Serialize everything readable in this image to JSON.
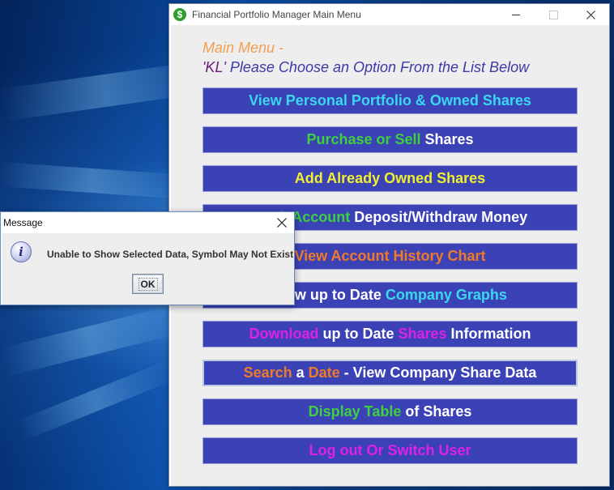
{
  "window": {
    "title": "Financial Portfolio Manager Main Menu",
    "icon": "dollar-icon",
    "icon_glyph": "$"
  },
  "header": {
    "line1": "Main Menu -",
    "user_quote": "'KL'",
    "line2_rest": " Please Choose an Option From the List Below"
  },
  "menu": {
    "items": [
      {
        "id": "view-portfolio",
        "parts": [
          {
            "text": "View Personal Portfolio & Owned Shares",
            "color": "cyan"
          }
        ]
      },
      {
        "id": "purchase-sell",
        "parts": [
          {
            "text": "Purchase or Sell",
            "color": "green"
          },
          {
            "text": " Shares",
            "color": "white"
          }
        ]
      },
      {
        "id": "add-owned",
        "parts": [
          {
            "text": "Add Already Owned Shares",
            "color": "yellow"
          }
        ]
      },
      {
        "id": "bank-account",
        "parts": [
          {
            "text": "Bank Account",
            "color": "green"
          },
          {
            "text": " Deposit/Withdraw Money",
            "color": "white"
          }
        ]
      },
      {
        "id": "account-history",
        "parts": [
          {
            "text": "View Account History Chart",
            "color": "orange"
          }
        ]
      },
      {
        "id": "company-graphs",
        "parts": [
          {
            "text": "View",
            "color": "white"
          },
          {
            "text": " up to Date ",
            "color": "white"
          },
          {
            "text": "Company Graphs",
            "color": "cyan"
          }
        ]
      },
      {
        "id": "download-info",
        "parts": [
          {
            "text": "Download",
            "color": "magenta"
          },
          {
            "text": " up to Date ",
            "color": "white"
          },
          {
            "text": "Shares",
            "color": "magenta"
          },
          {
            "text": " Information",
            "color": "white"
          }
        ]
      },
      {
        "id": "search-date",
        "focused": true,
        "parts": [
          {
            "text": "Search",
            "color": "orange"
          },
          {
            "text": " a ",
            "color": "white"
          },
          {
            "text": "Date",
            "color": "orange"
          },
          {
            "text": " - View Company Share Data",
            "color": "white"
          }
        ]
      },
      {
        "id": "display-table",
        "parts": [
          {
            "text": "Display Table",
            "color": "green"
          },
          {
            "text": " of Shares",
            "color": "white"
          }
        ]
      },
      {
        "id": "logout",
        "parts": [
          {
            "text": "Log out Or Switch User",
            "color": "magenta"
          }
        ]
      }
    ]
  },
  "dialog": {
    "title": "Message",
    "icon": "info-icon",
    "icon_glyph": "i",
    "message": "Unable to Show Selected Data, Symbol May Not Exist",
    "ok_label": "OK"
  }
}
